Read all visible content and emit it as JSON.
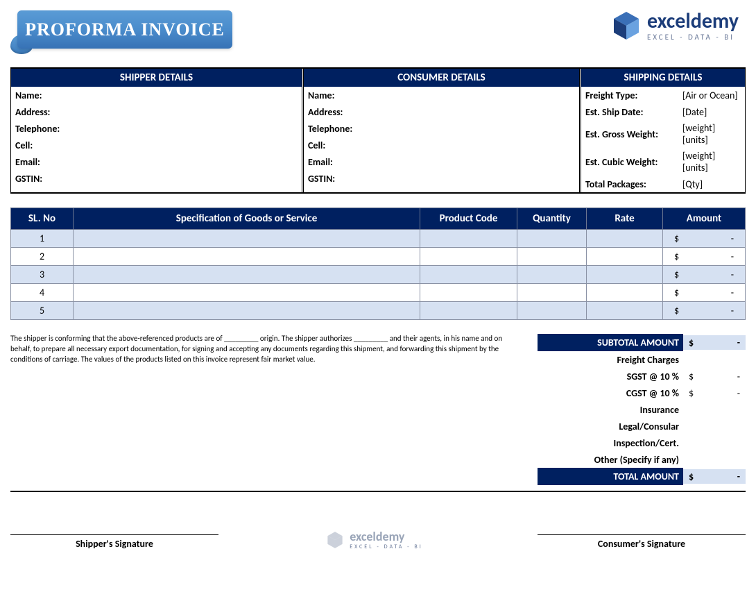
{
  "header": {
    "title": "PROFORMA INVOICE",
    "brand": "exceldemy",
    "brand_sub": "EXCEL - DATA - BI"
  },
  "details": {
    "shipper": {
      "heading": "SHIPPER DETAILS",
      "fields": [
        {
          "label": "Name:",
          "value": ""
        },
        {
          "label": "Address:",
          "value": ""
        },
        {
          "label": "Telephone:",
          "value": ""
        },
        {
          "label": "Cell:",
          "value": ""
        },
        {
          "label": "Email:",
          "value": ""
        },
        {
          "label": "GSTIN:",
          "value": ""
        }
      ]
    },
    "consumer": {
      "heading": "CONSUMER DETAILS",
      "fields": [
        {
          "label": "Name:",
          "value": ""
        },
        {
          "label": "Address:",
          "value": ""
        },
        {
          "label": "Telephone:",
          "value": ""
        },
        {
          "label": "Cell:",
          "value": ""
        },
        {
          "label": "Email:",
          "value": ""
        },
        {
          "label": "GSTIN:",
          "value": ""
        }
      ]
    },
    "shipping": {
      "heading": "SHIPPING DETAILS",
      "fields": [
        {
          "label": "Freight Type:",
          "value": "[Air or Ocean]"
        },
        {
          "label": "Est. Ship Date:",
          "value": "[Date]"
        },
        {
          "label": "Est. Gross Weight:",
          "value": "[weight] [units]"
        },
        {
          "label": "Est. Cubic Weight:",
          "value": "[weight] [units]"
        },
        {
          "label": "Total Packages:",
          "value": "[Qty]"
        }
      ]
    }
  },
  "items": {
    "columns": {
      "sl": "SL. No",
      "spec": "Specification of Goods or Service",
      "code": "Product Code",
      "qty": "Quantity",
      "rate": "Rate",
      "amount": "Amount"
    },
    "rows": [
      {
        "sl": "1",
        "spec": "",
        "code": "",
        "qty": "",
        "rate": "",
        "currency": "$",
        "amount": "-"
      },
      {
        "sl": "2",
        "spec": "",
        "code": "",
        "qty": "",
        "rate": "",
        "currency": "$",
        "amount": "-"
      },
      {
        "sl": "3",
        "spec": "",
        "code": "",
        "qty": "",
        "rate": "",
        "currency": "$",
        "amount": "-"
      },
      {
        "sl": "4",
        "spec": "",
        "code": "",
        "qty": "",
        "rate": "",
        "currency": "$",
        "amount": "-"
      },
      {
        "sl": "5",
        "spec": "",
        "code": "",
        "qty": "",
        "rate": "",
        "currency": "$",
        "amount": "-"
      }
    ]
  },
  "note": "The shipper is conforming that the above-referenced products are of _________ origin. The shipper authorizes _________ and their agents, in his name and on behalf, to prepare all necessary export documentation, for signing and accepting any documents regarding this shipment, and forwarding this shipment by the conditions of carriage. The values of the products listed on this invoice represent fair market value.",
  "totals": {
    "subtotal": {
      "label": "SUBTOTAL AMOUNT",
      "currency": "$",
      "value": "-"
    },
    "lines": [
      {
        "label": "Freight Charges",
        "currency": "",
        "value": ""
      },
      {
        "label": "SGST @ 10 %",
        "currency": "$",
        "value": "-"
      },
      {
        "label": "CGST @ 10 %",
        "currency": "$",
        "value": "-"
      },
      {
        "label": "Insurance",
        "currency": "",
        "value": ""
      },
      {
        "label": "Legal/Consular",
        "currency": "",
        "value": ""
      },
      {
        "label": "Inspection/Cert.",
        "currency": "",
        "value": ""
      },
      {
        "label": "Other (Specify if any)",
        "currency": "",
        "value": ""
      }
    ],
    "total": {
      "label": "TOTAL AMOUNT",
      "currency": "$",
      "value": "-"
    }
  },
  "signatures": {
    "shipper": "Shipper's Signature",
    "consumer": "Consumer's Signature"
  }
}
